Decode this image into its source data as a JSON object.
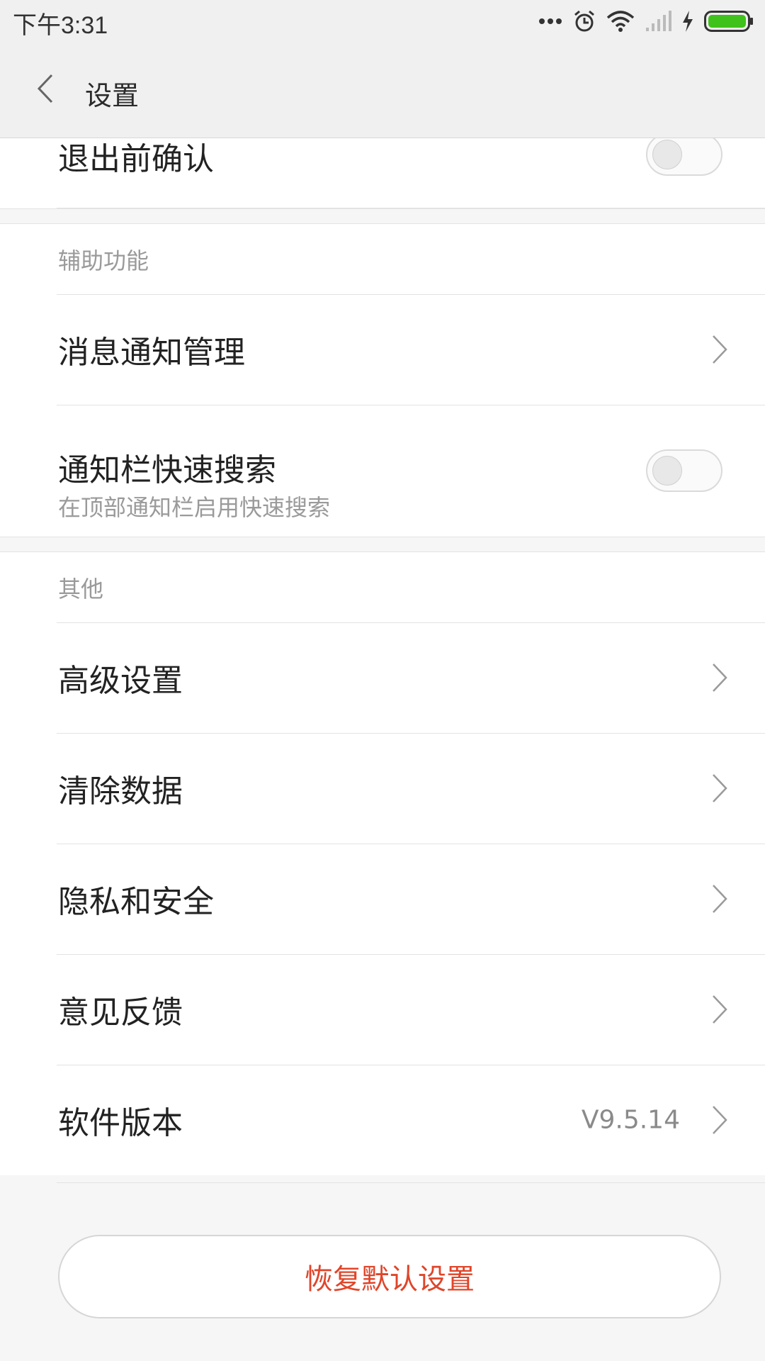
{
  "status_bar": {
    "time": "下午3:31",
    "icons": [
      "more-dots-icon",
      "alarm-icon",
      "wifi-icon",
      "signal-icon",
      "charging-icon",
      "battery-icon"
    ],
    "battery_color": "#3fc21b"
  },
  "header": {
    "title": "设置"
  },
  "top_partial_row": {
    "label": "退出前确认",
    "toggle_on": false
  },
  "sections": {
    "assist": {
      "header": "辅助功能",
      "notification_manage": "消息通知管理",
      "quick_search": {
        "title": "通知栏快速搜索",
        "subtitle": "在顶部通知栏启用快速搜索",
        "toggle_on": false
      }
    },
    "other": {
      "header": "其他",
      "advanced": "高级设置",
      "clear_data": "清除数据",
      "privacy": "隐私和安全",
      "feedback": "意见反馈",
      "version_label": "软件版本",
      "version_value": "V9.5.14"
    }
  },
  "reset_button": "恢复默认设置",
  "colors": {
    "accent_red": "#e0452a"
  }
}
